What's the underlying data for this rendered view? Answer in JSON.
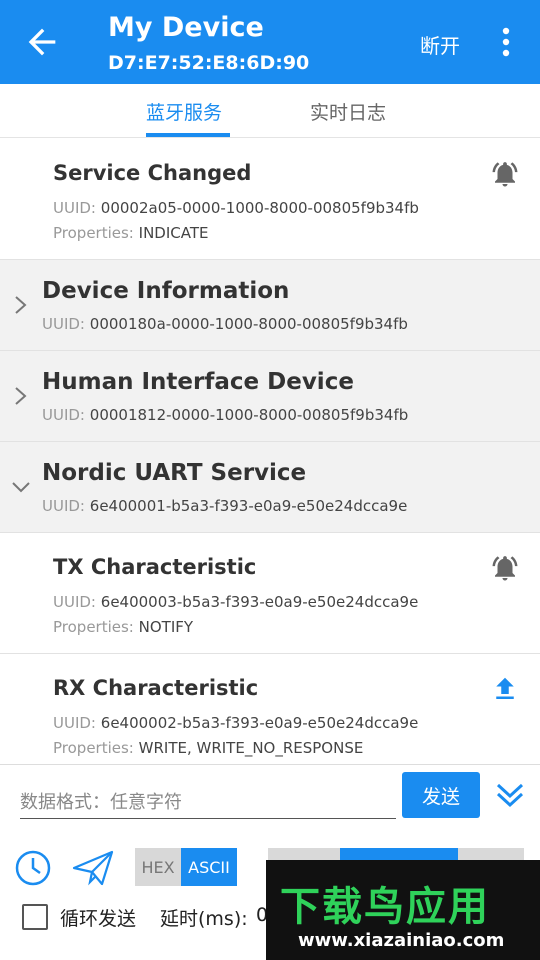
{
  "appbar": {
    "title": "My Device",
    "subtitle": "D7:E7:52:E8:6D:90",
    "disconnect_label": "断开"
  },
  "tabs": [
    {
      "label": "蓝牙服务",
      "active": true
    },
    {
      "label": "实时日志",
      "active": false
    }
  ],
  "labels": {
    "uuid": "UUID:",
    "properties": "Properties:"
  },
  "items": [
    {
      "kind": "characteristic",
      "name": "Service Changed",
      "uuid": "00002a05-0000-1000-8000-00805f9b34fb",
      "properties": "INDICATE",
      "icon": "bell-icon"
    },
    {
      "kind": "service",
      "name": "Device Information",
      "uuid": "0000180a-0000-1000-8000-00805f9b34fb",
      "expanded": false
    },
    {
      "kind": "service",
      "name": "Human Interface Device",
      "uuid": "00001812-0000-1000-8000-00805f9b34fb",
      "expanded": false
    },
    {
      "kind": "service",
      "name": "Nordic UART Service",
      "uuid": "6e400001-b5a3-f393-e0a9-e50e24dcca9e",
      "expanded": true
    },
    {
      "kind": "characteristic",
      "name": "TX Characteristic",
      "uuid": "6e400003-b5a3-f393-e0a9-e50e24dcca9e",
      "properties": "NOTIFY",
      "icon": "bell-icon"
    },
    {
      "kind": "characteristic",
      "name": "RX Characteristic",
      "uuid": "6e400002-b5a3-f393-e0a9-e50e24dcca9e",
      "properties": "WRITE, WRITE_NO_RESPONSE",
      "icon": "upload-arrow-icon"
    }
  ],
  "bottom": {
    "input_placeholder": "数据格式：任意字符",
    "input_value": "",
    "send_label": "发送",
    "hex_label": "HEX",
    "ascii_label": "ASCII",
    "selected_format": "ASCII",
    "loop_label": "循环发送",
    "loop_checked": false,
    "delay_label": "延时(ms):",
    "delay_value": "0"
  },
  "watermark": {
    "logo_text": "下载鸟应用",
    "url": "www.xiazainiao.com"
  },
  "colors": {
    "primary": "#1a8cf0",
    "service_bg": "#f2f2f2",
    "watermark_green": "#2fd25a"
  }
}
